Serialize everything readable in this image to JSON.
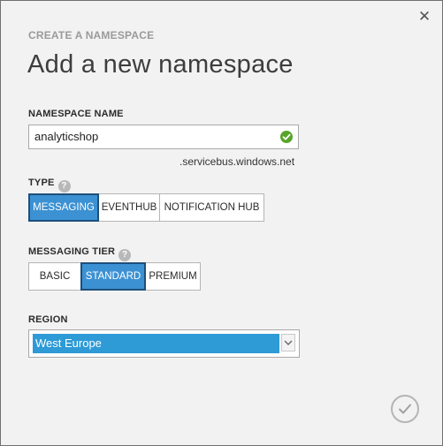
{
  "dialog": {
    "caption": "CREATE A NAMESPACE",
    "title": "Add a new namespace",
    "close_icon": "close-icon",
    "confirm_icon": "checkmark-icon"
  },
  "namespace": {
    "label": "NAMESPACE NAME",
    "value": "analyticshop",
    "suffix": ".servicebus.windows.net",
    "valid_icon": "valid-check-icon",
    "valid_color": "#58a52a"
  },
  "type": {
    "label": "TYPE",
    "help": "?",
    "options": [
      "MESSAGING",
      "EVENTHUB",
      "NOTIFICATION HUB"
    ],
    "selected": "MESSAGING"
  },
  "tier": {
    "label": "MESSAGING TIER",
    "help": "?",
    "options": [
      "BASIC",
      "STANDARD",
      "PREMIUM"
    ],
    "selected": "STANDARD"
  },
  "region": {
    "label": "REGION",
    "selected": "West Europe",
    "arrow_icon": "chevron-down-icon"
  },
  "colors": {
    "accent": "#3c91d3",
    "selection": "#2e9ad6",
    "background": "#f2f2f2"
  }
}
